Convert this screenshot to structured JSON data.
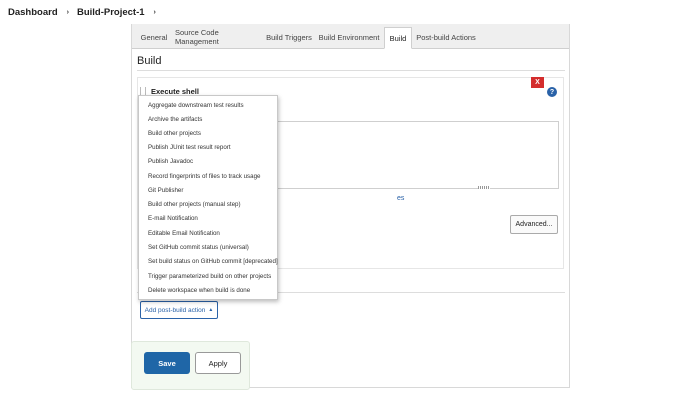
{
  "breadcrumb": {
    "items": [
      "Dashboard",
      "Build-Project-1"
    ],
    "separator": "›"
  },
  "tabs": [
    {
      "label": "General",
      "active": false
    },
    {
      "label": "Source Code Management",
      "active": false
    },
    {
      "label": "Build Triggers",
      "active": false
    },
    {
      "label": "Build Environment",
      "active": false
    },
    {
      "label": "Build",
      "active": true
    },
    {
      "label": "Post-build Actions",
      "active": false
    }
  ],
  "section": {
    "title": "Build"
  },
  "build_step": {
    "title": "Execute shell",
    "delete_label": "X",
    "help_label": "?",
    "env_link_text": "es",
    "advanced_label": "Advanced..."
  },
  "post_build": {
    "add_button_label": "Add post-build action",
    "caret": "▲"
  },
  "dropdown": {
    "items": [
      "Aggregate downstream test results",
      "Archive the artifacts",
      "Build other projects",
      "Publish JUnit test result report",
      "Publish Javadoc",
      "Record fingerprints of files to track usage",
      "Git Publisher",
      "Build other projects (manual step)",
      "E-mail Notification",
      "Editable Email Notification",
      "Set GitHub commit status (universal)",
      "Set build status on GitHub commit [deprecated]",
      "Trigger parameterized build on other projects",
      "Delete workspace when build is done"
    ]
  },
  "actions": {
    "save_label": "Save",
    "apply_label": "Apply"
  },
  "colors": {
    "accent": "#1f66a7",
    "delete": "#d42d2d",
    "link": "#2a62a8"
  }
}
